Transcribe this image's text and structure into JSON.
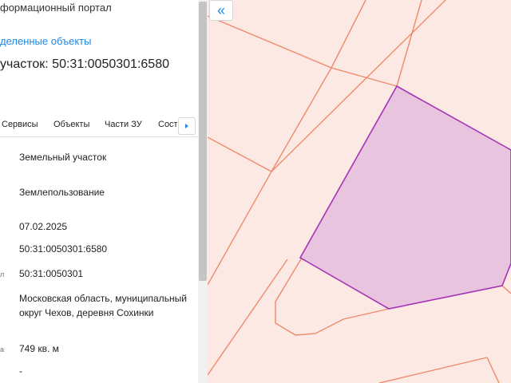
{
  "header": {
    "portal_title": "формационный портал",
    "selected_link": "деленные объекты",
    "parcel_title": "участок: 50:31:0050301:6580"
  },
  "tabs": [
    {
      "label": "Сервисы"
    },
    {
      "label": "Объекты"
    },
    {
      "label": "Части ЗУ"
    },
    {
      "label": "Соста"
    }
  ],
  "tab_scroll_icon": "chevron-right-icon",
  "fields": [
    {
      "label": "",
      "value": "Земельный участок"
    },
    {
      "label": "",
      "value": "Землепользование"
    },
    {
      "label": "",
      "value": "07.02.2025"
    },
    {
      "label": "",
      "value": "50:31:0050301:6580"
    },
    {
      "label": "л",
      "value": "50:31:0050301"
    },
    {
      "label": "",
      "value": "Московская область, муниципальный округ Чехов, деревня Сохинки"
    },
    {
      "label": "а",
      "value": "749 кв. м"
    },
    {
      "label": "",
      "value": "-"
    }
  ],
  "map": {
    "collapse_icon": "double-chevron-left-icon",
    "collapse_label": "«",
    "background_color": "#fde9e4",
    "boundary_color": "#ee8a6a",
    "parcel_fill": "#e9c4df",
    "parcel_stroke": "#a433b8"
  }
}
